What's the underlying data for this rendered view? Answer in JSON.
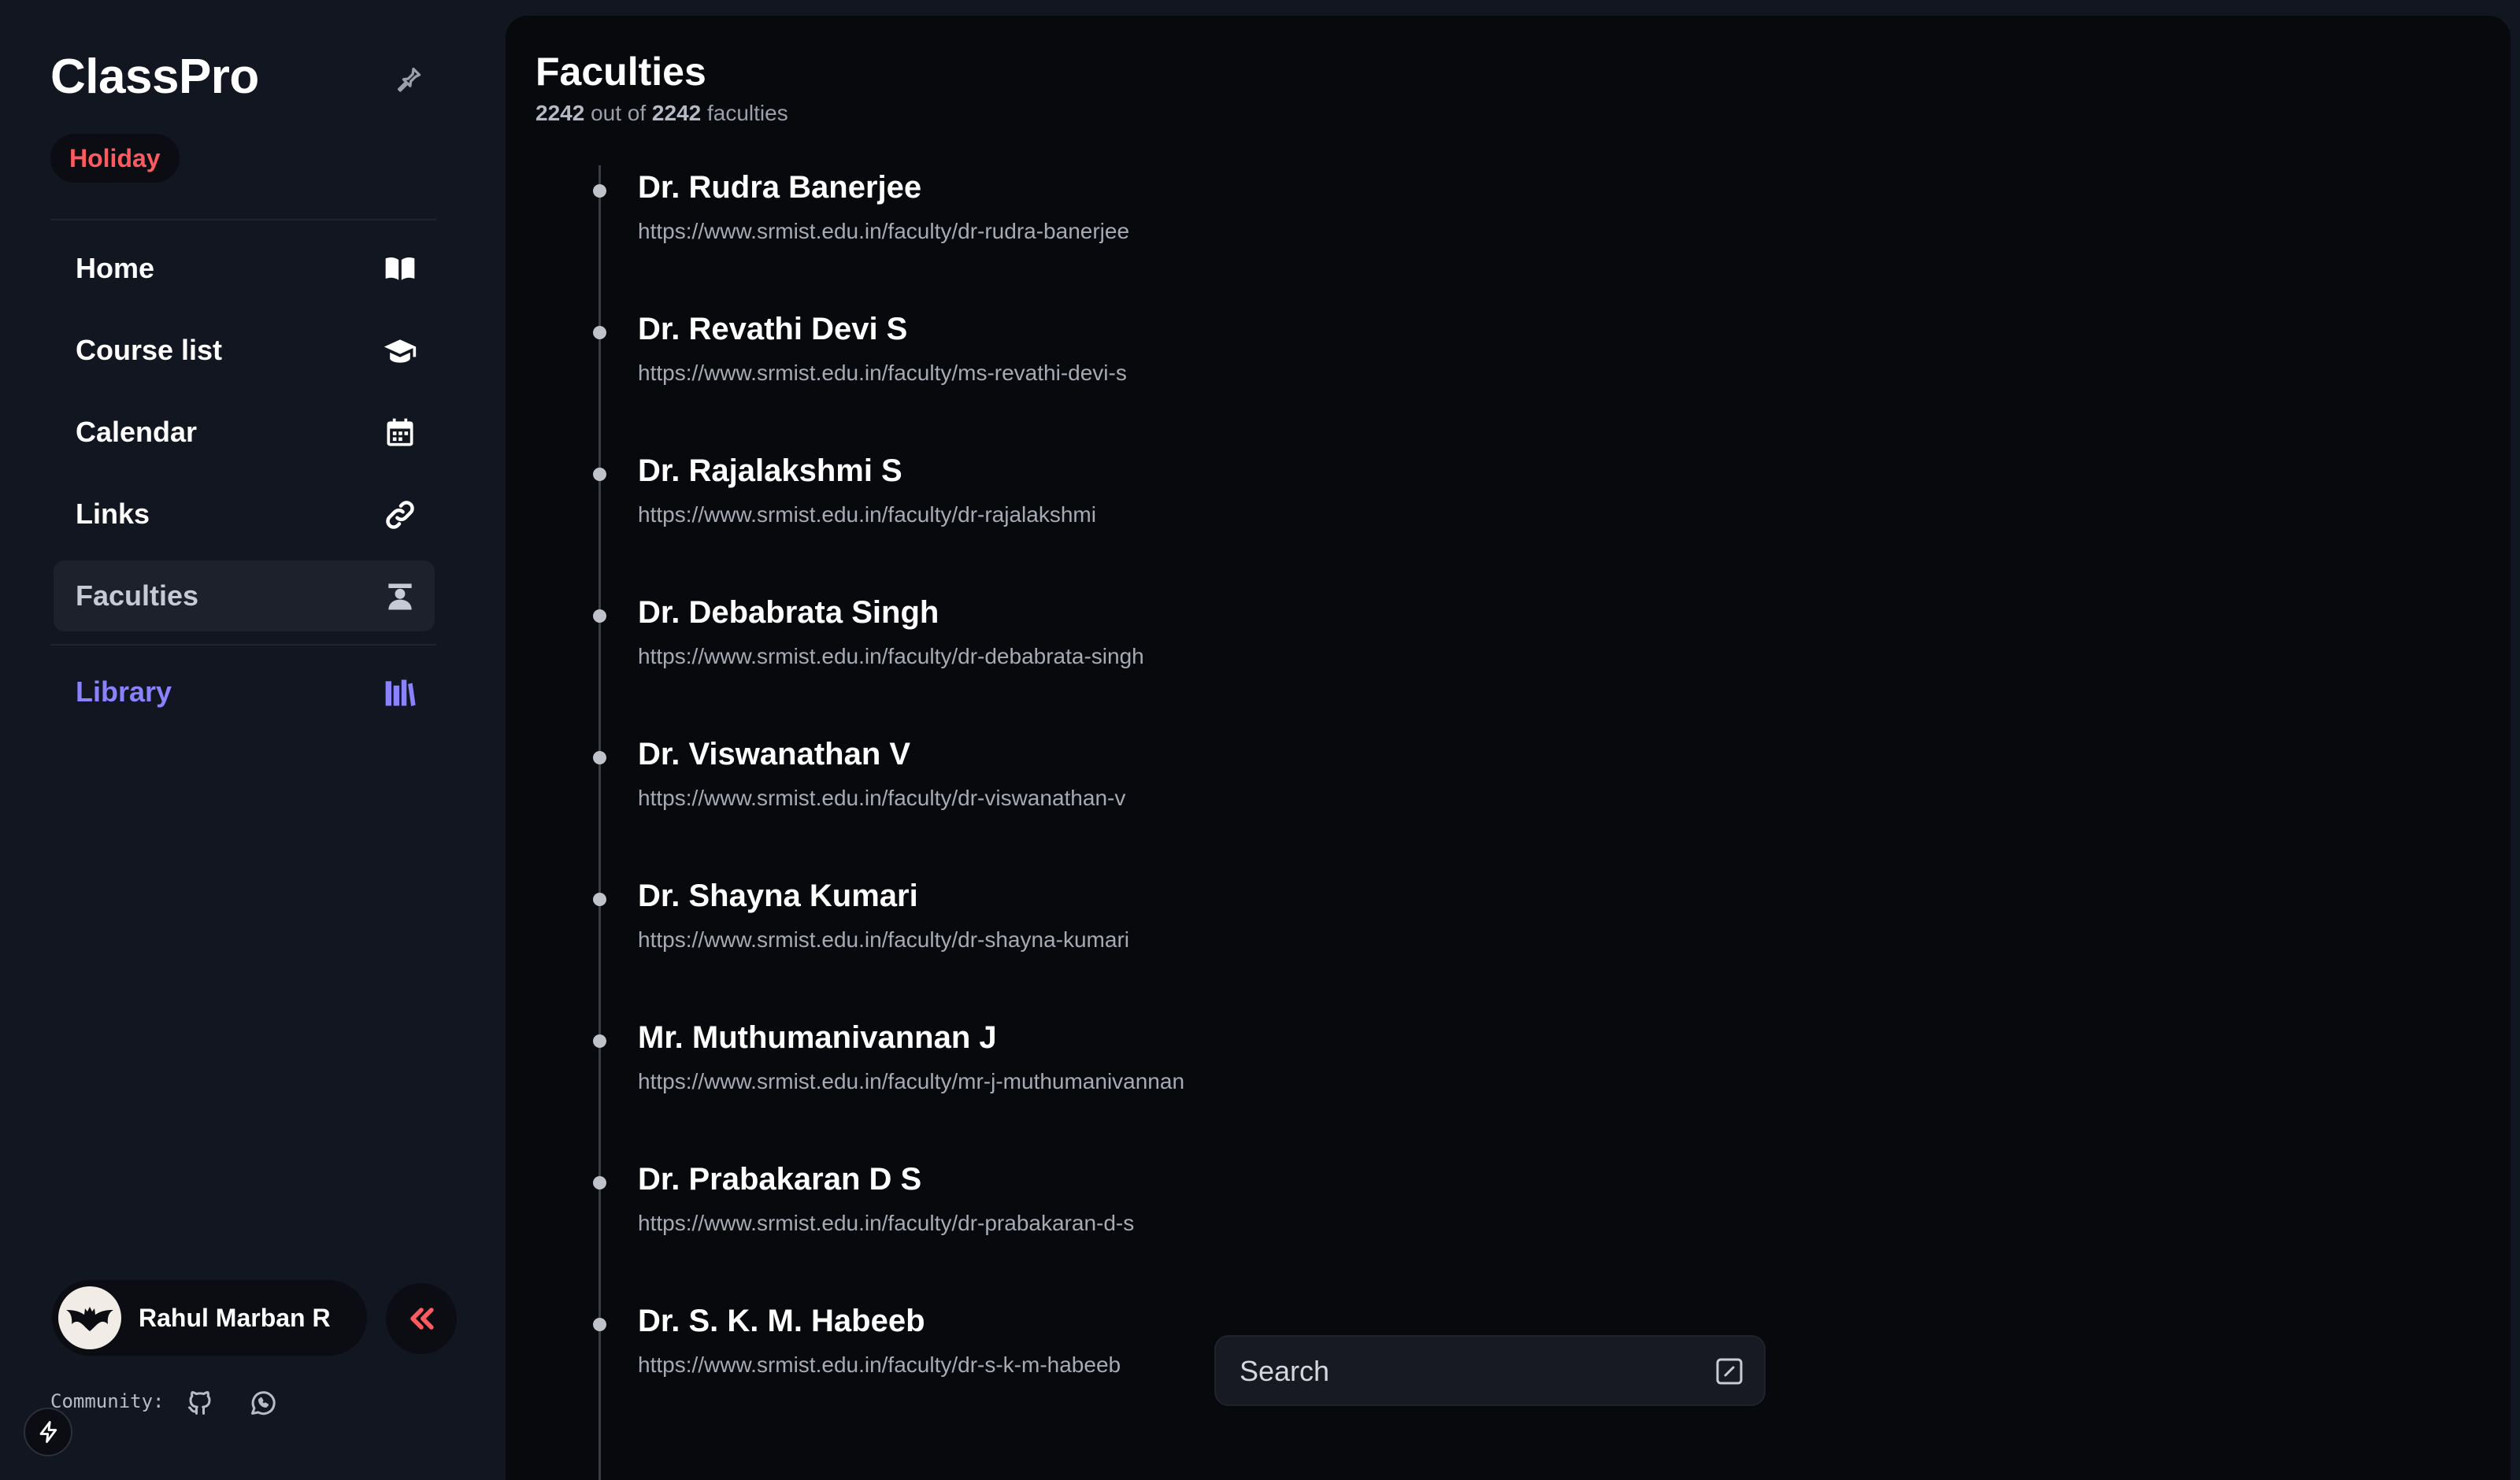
{
  "app": {
    "brand": "ClassPro",
    "status_badge": "Holiday"
  },
  "sidebar": {
    "items": [
      {
        "label": "Home",
        "icon": "book-open-icon"
      },
      {
        "label": "Course list",
        "icon": "graduation-cap-icon"
      },
      {
        "label": "Calendar",
        "icon": "calendar-icon"
      },
      {
        "label": "Links",
        "icon": "link-icon"
      },
      {
        "label": "Faculties",
        "icon": "teacher-icon",
        "active": true
      }
    ],
    "library": {
      "label": "Library",
      "icon": "library-icon"
    }
  },
  "user": {
    "name": "Rahul Marban R",
    "avatar": "bat-logo-icon"
  },
  "community": {
    "label": "Community:",
    "icons": [
      "github-icon",
      "whatsapp-icon"
    ]
  },
  "main": {
    "title": "Faculties",
    "count_shown": "2242",
    "count_middle": " out of ",
    "count_total": "2242",
    "count_suffix": " faculties",
    "faculties": [
      {
        "name": "Dr. Rudra Banerjee",
        "url": "https://www.srmist.edu.in/faculty/dr-rudra-banerjee"
      },
      {
        "name": "Dr. Revathi Devi S",
        "url": "https://www.srmist.edu.in/faculty/ms-revathi-devi-s"
      },
      {
        "name": "Dr. Rajalakshmi S",
        "url": "https://www.srmist.edu.in/faculty/dr-rajalakshmi"
      },
      {
        "name": "Dr. Debabrata Singh",
        "url": "https://www.srmist.edu.in/faculty/dr-debabrata-singh"
      },
      {
        "name": "Dr. Viswanathan V",
        "url": "https://www.srmist.edu.in/faculty/dr-viswanathan-v"
      },
      {
        "name": "Dr. Shayna Kumari",
        "url": "https://www.srmist.edu.in/faculty/dr-shayna-kumari"
      },
      {
        "name": "Mr. Muthumanivannan J",
        "url": "https://www.srmist.edu.in/faculty/mr-j-muthumanivannan"
      },
      {
        "name": "Dr. Prabakaran D S",
        "url": "https://www.srmist.edu.in/faculty/dr-prabakaran-d-s"
      },
      {
        "name": "Dr. S. K. M. Habeeb",
        "url": "https://www.srmist.edu.in/faculty/dr-s-k-m-habeeb"
      }
    ],
    "search": {
      "placeholder": "Search"
    }
  },
  "colors": {
    "background": "#121620",
    "panel": "#08090d",
    "accent_red": "#ff5a5f",
    "accent_purple": "#8b82ff"
  }
}
